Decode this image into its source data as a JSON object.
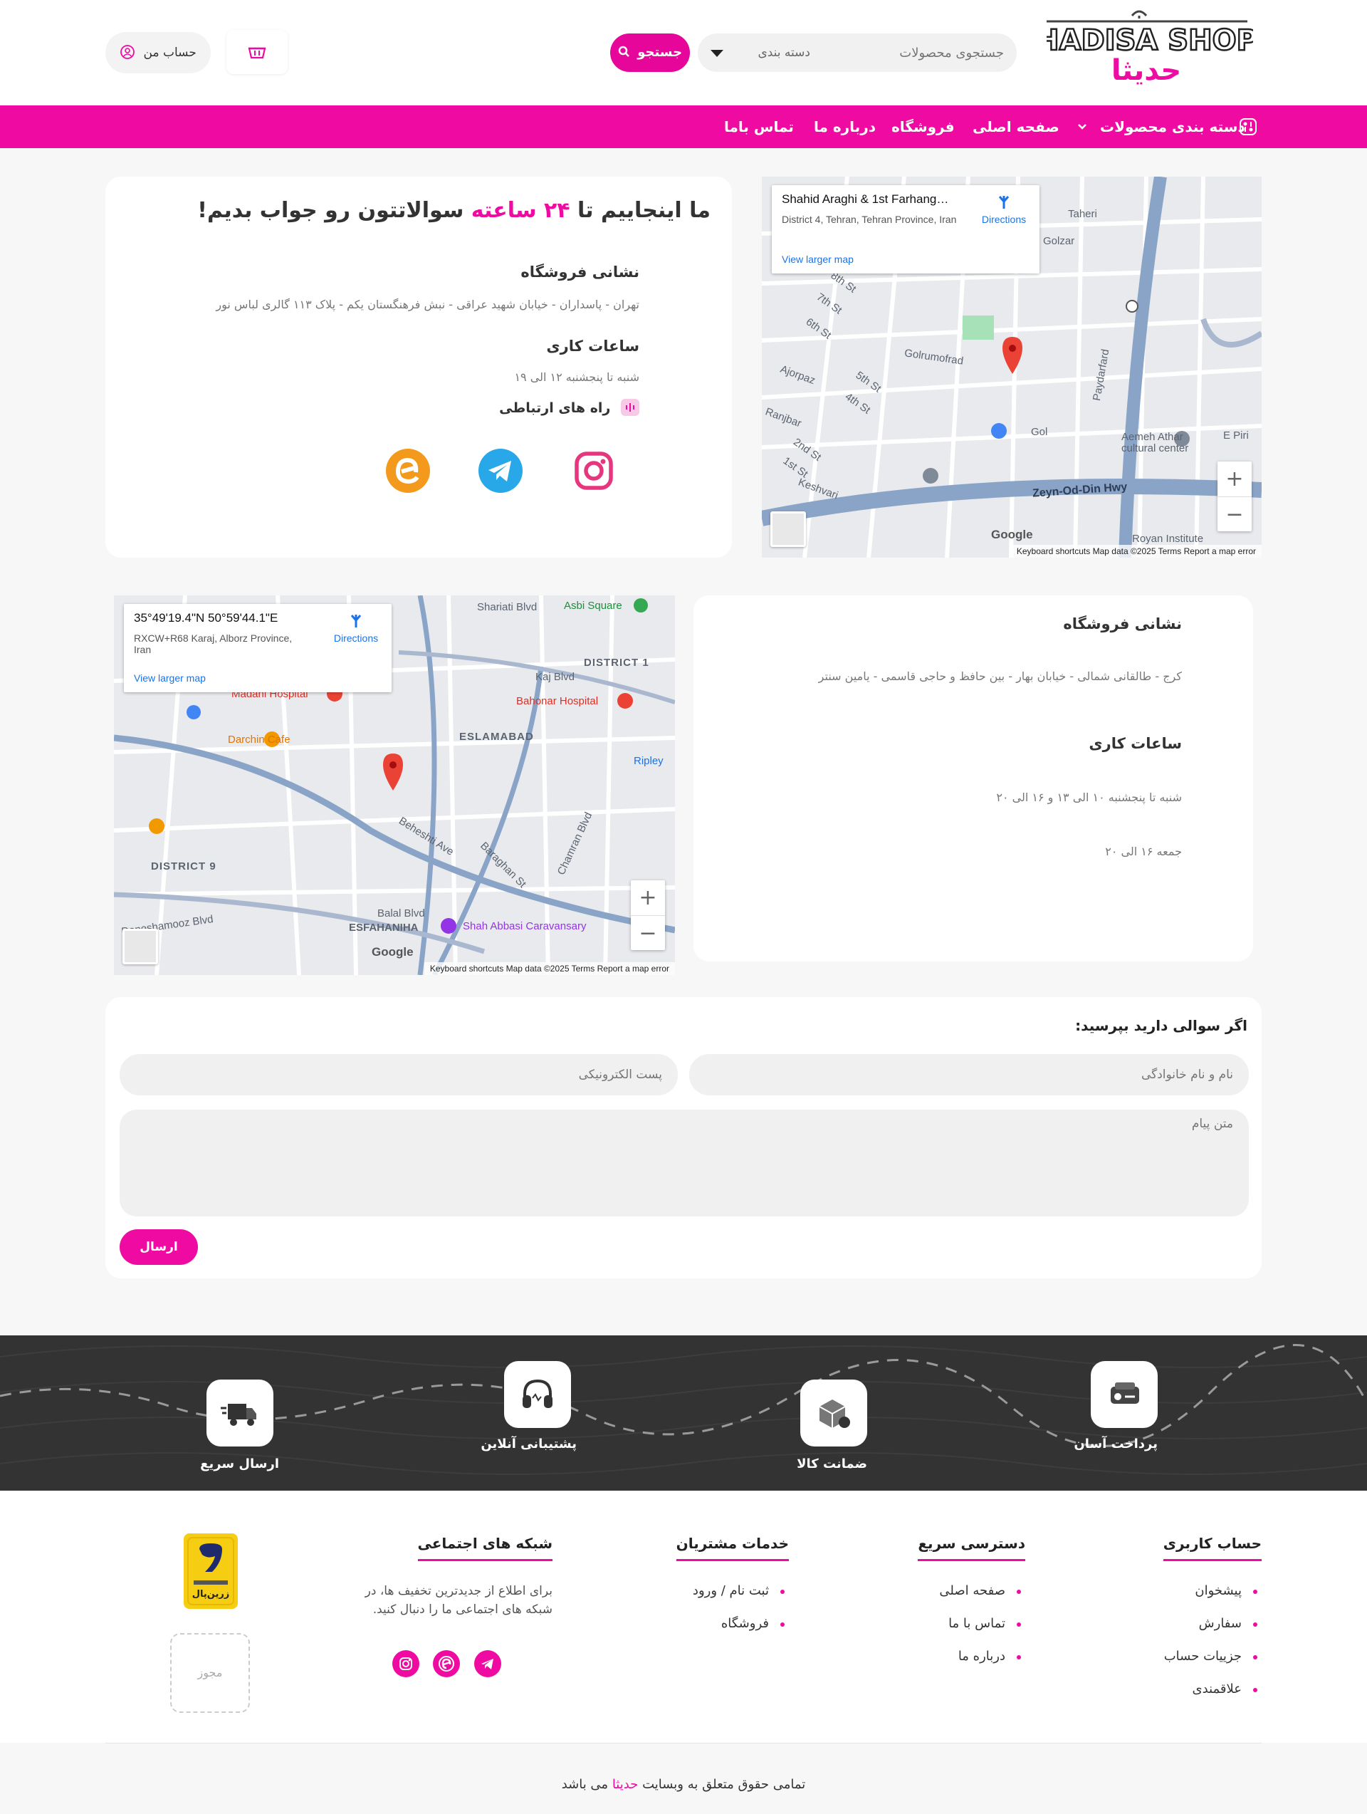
{
  "header": {
    "logo_text_en": "HADISA SHOP",
    "logo_text_fa": "حدیثا",
    "search_placeholder": "جستجوی محصولات",
    "category_select": "دسته بندی",
    "search_button": "جستجو",
    "account_label": "حساب من"
  },
  "nav": {
    "categories": "دسته بندی محصولات",
    "items": [
      "صفحه اصلی",
      "فروشگاه",
      "درباره ما",
      "تماس باما"
    ]
  },
  "contact_card": {
    "headline_pre": "ما اینجاییم تا",
    "headline_highlight": "۲۴ ساعته",
    "headline_post": "سوالاتتون رو جواب بدیم!",
    "address_title": "نشانی فروشگاه",
    "address": "تهران - پاسداران - خیابان شهید عراقی - نبش فرهنگستان یکم - پلاک ۱۱۳ گالری لباس نور",
    "hours_title": "ساعات کاری",
    "hours": "شنبه تا پنجشنبه ۱۲ الی ۱۹",
    "contact_title": "راه های ارتباطی"
  },
  "map1": {
    "place": "Shahid Araghi & 1st Farhang…",
    "address": "District 4, Tehran, Tehran Province, Iran",
    "link": "View larger map",
    "directions": "Directions",
    "road": "Zeyn-Od-Din Hwy",
    "labels": [
      "Taheri",
      "Golzar",
      "Golrumofrad",
      "Gol",
      "Paydarfard",
      "Ajorpaz",
      "Ranjbar",
      "Keshvari",
      "Aemeh Athar cultural center",
      "E Piri",
      "Royan Institute",
      "8th St",
      "7th St",
      "6th St",
      "5th St",
      "4th St",
      "2nd St",
      "1st St"
    ],
    "footer": "Keyboard shortcuts    Map data ©2025    Terms    Report a map error",
    "google": "Google"
  },
  "map2": {
    "place": "35°49'19.4\"N 50°59'44.1\"E",
    "address": "RXCW+R68 Karaj, Alborz Province, Iran",
    "link": "View larger map",
    "directions": "Directions",
    "labels": [
      "Shariati Blvd",
      "Asbi Square",
      "DISTRICT 1",
      "Kaj Blvd",
      "Madani Hospital",
      "Bahonar Hospital",
      "ESLAMABAD",
      "Darchin Cafe",
      "Ripley",
      "DISTRICT 9",
      "Beheshti Ave",
      "Baraghan St",
      "Chamran Blvd",
      "Balal Blvd",
      "Daneshamooz Blvd",
      "ESFAHANIHA",
      "Shah Abbasi Caravansary"
    ],
    "footer": "Keyboard shortcuts    Map data ©2025    Terms    Report a map error",
    "google": "Google"
  },
  "branch_card": {
    "address_title": "نشانی فروشگاه",
    "address": "کرج - طالقانی شمالی - خیابان بهار - بین حافظ و حاجی قاسمی - یامین سنتر",
    "hours_title": "ساعات کاری",
    "hours1": "شنبه تا پنجشنبه ۱۰ الی ۱۳ و ۱۶ الی ۲۰",
    "hours2": "جمعه ۱۶ الی ۲۰"
  },
  "form": {
    "title": "اگر سوالی دارید بپرسید:",
    "name_placeholder": "نام و نام خانوادگی",
    "email_placeholder": "پست الکترونیکی",
    "message_placeholder": "متن پیام",
    "submit": "ارسال"
  },
  "features": [
    {
      "label": "پرداخت آسان",
      "icon": "payment-icon"
    },
    {
      "label": "ضمانت کالا",
      "icon": "box-icon"
    },
    {
      "label": "پشتیبانی آنلاین",
      "icon": "headset-icon"
    },
    {
      "label": "ارسال سریع",
      "icon": "truck-icon"
    }
  ],
  "footer": {
    "account_title": "حساب کاربری",
    "account_items": [
      "پیشخوان",
      "سفارش",
      "جزییات حساب",
      "علاقمندی"
    ],
    "quick_title": "دسترسی سریع",
    "quick_items": [
      "صفحه اصلی",
      "تماس با ما",
      "درباره ما"
    ],
    "services_title": "خدمات مشتریان",
    "services_items": [
      "ثبت نام / ورود",
      "فروشگاه"
    ],
    "social_title": "شبکه های اجتماعی",
    "social_text": "برای اطلاع از جدیدترین تخفیف ها، در شبکه های اجتماعی ما را دنبال کنید.",
    "zarinpal_text": "زرین‌پال",
    "license": "مجوز"
  },
  "copyright": {
    "pre": "تمامی حقوق متعلق به وبسایت",
    "brand": "حدیثا",
    "post": "می باشد"
  },
  "colors": {
    "accent": "#ef0ba1",
    "dark": "#333333"
  }
}
